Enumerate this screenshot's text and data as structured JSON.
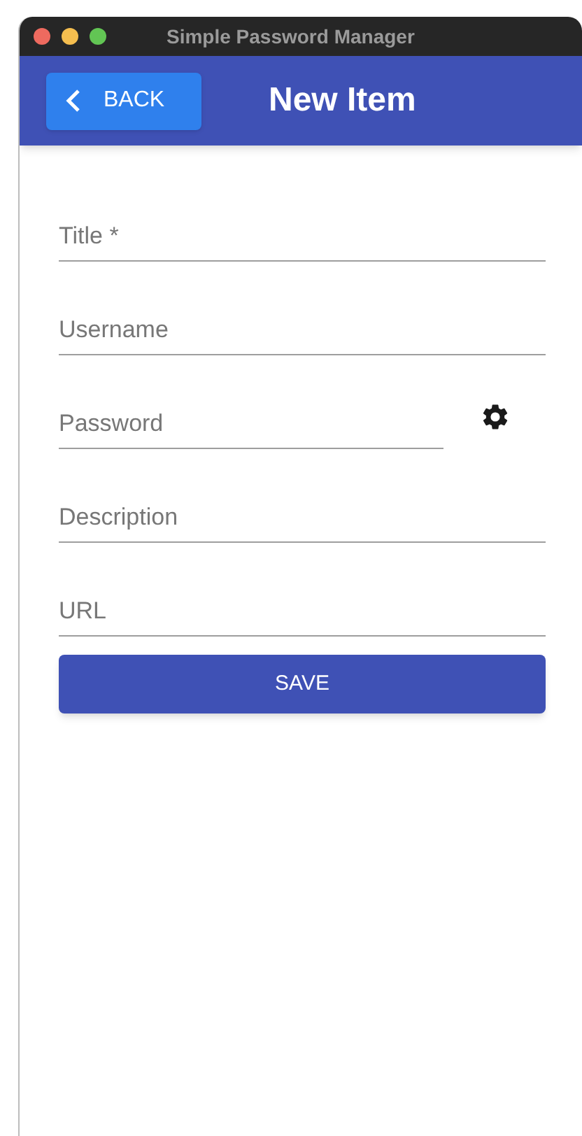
{
  "window": {
    "title": "Simple Password Manager"
  },
  "app_bar": {
    "back_button": "BACK",
    "title": "New Item"
  },
  "fields": [
    {
      "placeholder": "Title *",
      "kind": "text"
    },
    {
      "placeholder": "Username",
      "kind": "text"
    },
    {
      "placeholder": "Password",
      "kind": "password"
    },
    {
      "placeholder": "Description",
      "kind": "text"
    },
    {
      "placeholder": "URL",
      "kind": "text"
    }
  ],
  "save_button": "SAVE"
}
